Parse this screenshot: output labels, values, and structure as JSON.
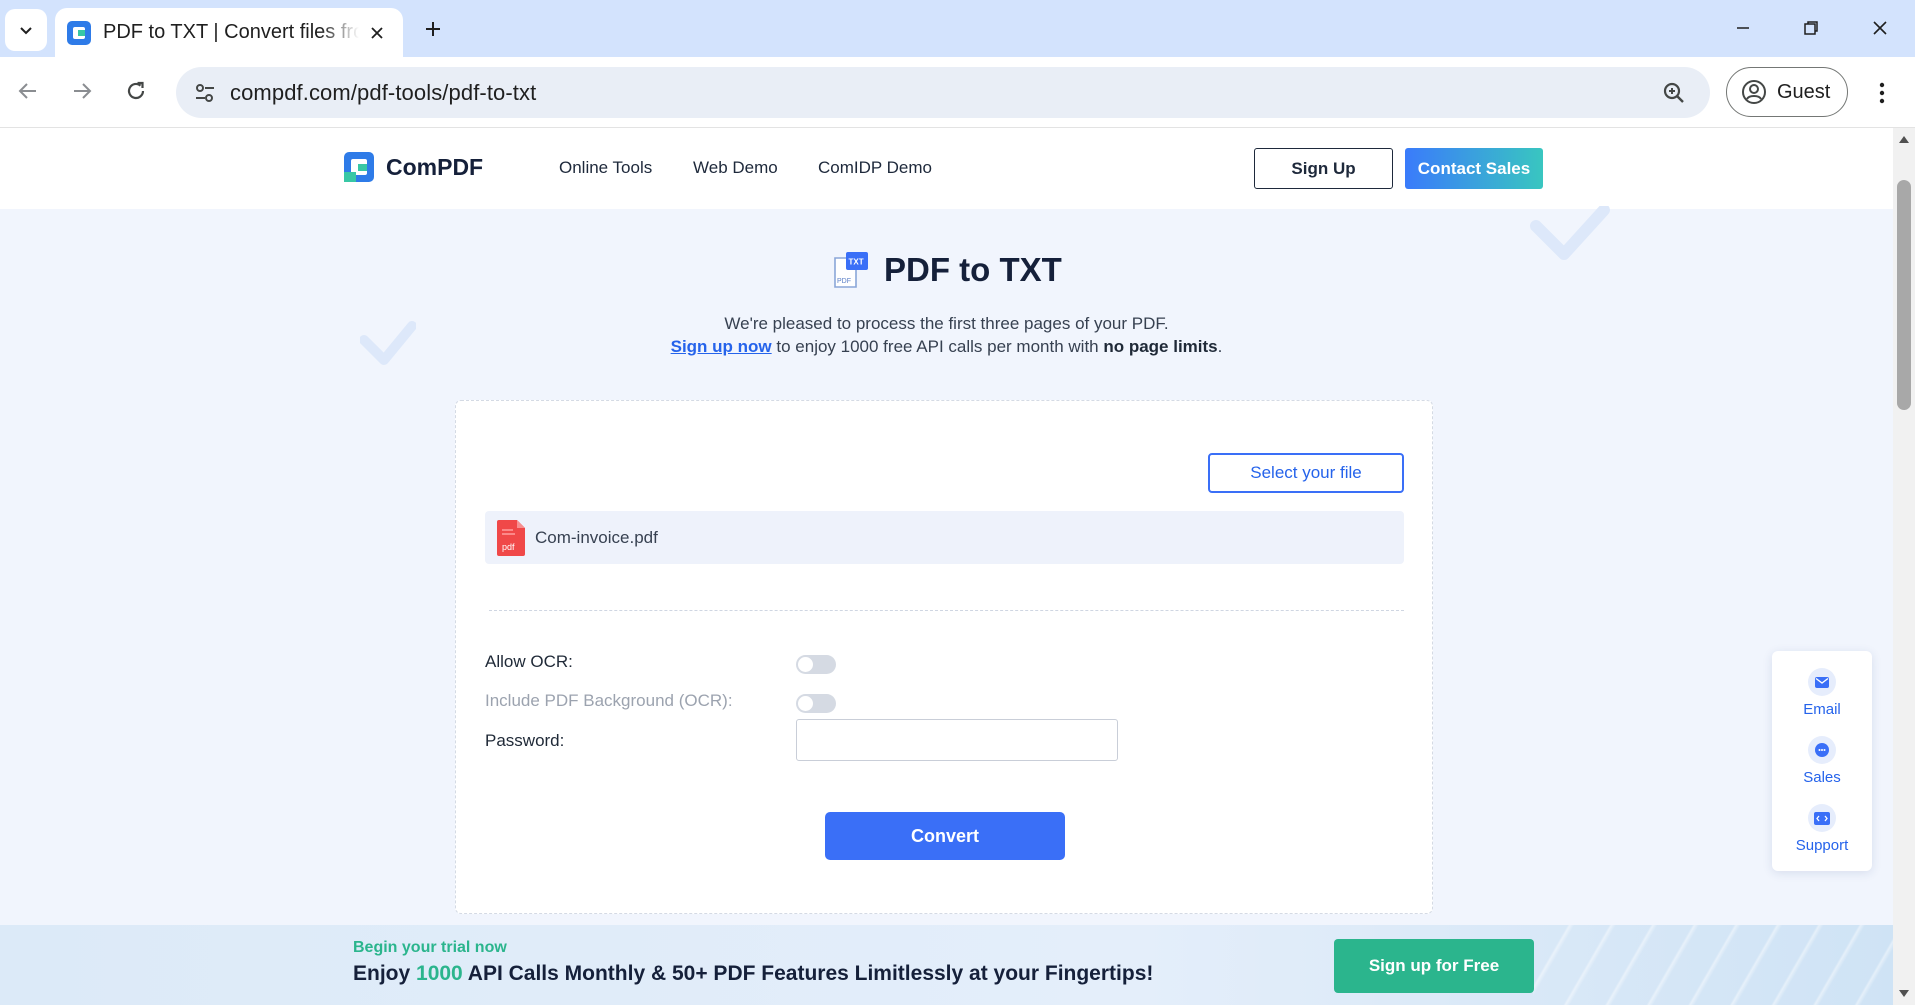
{
  "browser": {
    "tab_title": "PDF to TXT | Convert files from PDF to TXT",
    "url": "compdf.com/pdf-tools/pdf-to-txt",
    "profile_label": "Guest"
  },
  "header": {
    "brand": "ComPDF",
    "nav": [
      "Online Tools",
      "Web Demo",
      "ComIDP Demo"
    ],
    "signup_label": "Sign Up",
    "contact_label": "Contact Sales"
  },
  "hero": {
    "icon_badge": "TXT",
    "icon_sub": "PDF",
    "title": "PDF to TXT",
    "line1": "We're pleased to process the first three pages of your PDF.",
    "signup_link": "Sign up now",
    "line2_middle": " to enjoy 1000 free API calls per month with ",
    "line2_bold": "no page limits",
    "line2_end": "."
  },
  "tool": {
    "select_file_label": "Select your file",
    "file_name": "Com-invoice.pdf",
    "file_icon_label": "pdf",
    "allow_ocr_label": "Allow OCR:",
    "include_bg_label": "Include PDF Background (OCR):",
    "password_label": "Password:",
    "password_value": "",
    "convert_label": "Convert"
  },
  "float_panel": {
    "items": [
      {
        "label": "Email",
        "icon": "email-icon"
      },
      {
        "label": "Sales",
        "icon": "chat-icon"
      },
      {
        "label": "Support",
        "icon": "code-icon"
      }
    ]
  },
  "banner": {
    "kicker": "Begin your trial now",
    "headline_pre": "Enjoy ",
    "headline_num": "1000",
    "headline_post": " API Calls Monthly & 50+ PDF Features Limitlessly at your Fingertips!",
    "cta_label": "Sign up for Free"
  },
  "colors": {
    "accent": "#3a6ff7",
    "brand_green": "#2bb58d",
    "link": "#2563eb"
  }
}
